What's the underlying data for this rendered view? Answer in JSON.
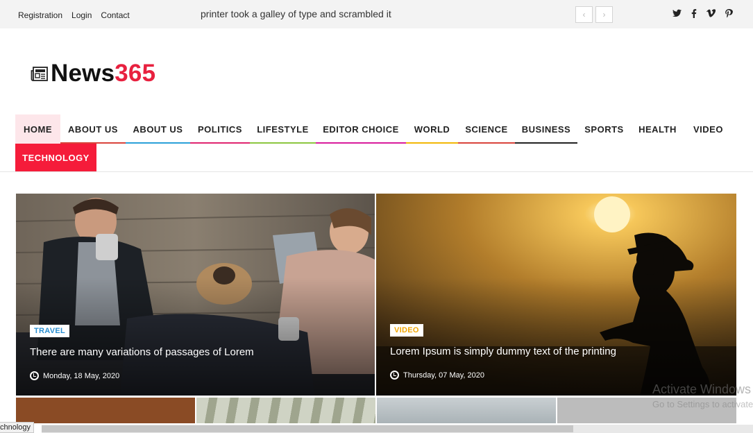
{
  "topbar": {
    "links": [
      "Registration",
      "Login",
      "Contact"
    ],
    "ticker": "printer took a galley of type and scrambled it",
    "prev_icon": "chevron-left-icon",
    "next_icon": "chevron-right-icon",
    "social": [
      {
        "name": "twitter-icon",
        "glyph": "𝙩"
      },
      {
        "name": "facebook-icon",
        "glyph": "f"
      },
      {
        "name": "vimeo-icon",
        "glyph": "v"
      },
      {
        "name": "pinterest-icon",
        "glyph": "p"
      }
    ]
  },
  "logo": {
    "text_main": "News",
    "text_accent": "365",
    "accent_color": "#e8213f",
    "icon": "newspaper-icon"
  },
  "nav": {
    "items": [
      {
        "label": "HOME",
        "color": ""
      },
      {
        "label": "ABOUT US",
        "color": "#d9433b"
      },
      {
        "label": "ABOUT US",
        "color": "#2aa0d8"
      },
      {
        "label": "POLITICS",
        "color": "#e0246f"
      },
      {
        "label": "LIFESTYLE",
        "color": "#8cc63f"
      },
      {
        "label": "EDITOR CHOICE",
        "color": "#d81b9c"
      },
      {
        "label": "WORLD",
        "color": "#f2b705"
      },
      {
        "label": "SCIENCE",
        "color": "#d9433b"
      },
      {
        "label": "BUSINESS",
        "color": "#222222"
      },
      {
        "label": "SPORTS",
        "color": ""
      },
      {
        "label": "HEALTH",
        "color": ""
      },
      {
        "label": "VIDEO",
        "color": ""
      }
    ],
    "active_second_row": "TECHNOLOGY",
    "active_color": "#f51c3a"
  },
  "cards": [
    {
      "badge": "TRAVEL",
      "badge_color": "#2a8fd1",
      "title": "There are many variations of passages of Lorem",
      "date": "Monday, 18 May, 2020"
    },
    {
      "badge": "VIDEO",
      "badge_color": "#f2a600",
      "title": "Lorem Ipsum is simply dummy text of the printing",
      "date": "Thursday, 07 May, 2020"
    }
  ],
  "watermark": {
    "line1": "Activate Windows",
    "line2": "Go to Settings to activate Windows."
  },
  "status": {
    "text": "chnology"
  }
}
